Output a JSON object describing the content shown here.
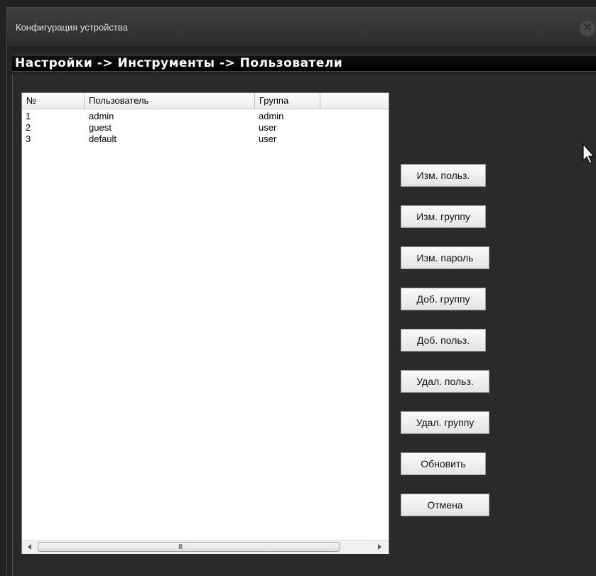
{
  "window": {
    "title": "Конфигурация устройства",
    "close_symbol": "✕"
  },
  "breadcrumb": "Настройки -> Инструменты -> Пользователи",
  "table": {
    "columns": [
      "№",
      "Пользователь",
      "Группа"
    ],
    "rows": [
      {
        "num": "1",
        "user": "admin",
        "group": "admin"
      },
      {
        "num": "2",
        "user": "guest",
        "group": "user"
      },
      {
        "num": "3",
        "user": "default",
        "group": "user"
      }
    ],
    "scroll_grip": "III"
  },
  "buttons": {
    "edit_user": "Изм. польз.",
    "edit_group": "Изм. группу",
    "edit_password": "Изм. пароль",
    "add_group": "Доб. группу",
    "add_user": "Доб. польз.",
    "delete_user": "Удал. польз.",
    "delete_group": "Удал. группу",
    "refresh": "Обновить",
    "cancel": "Отмена"
  },
  "icons": {
    "close": "close-icon",
    "scroll_left": "chevron-left-icon",
    "scroll_right": "chevron-right-icon",
    "cursor": "mouse-pointer-icon"
  }
}
